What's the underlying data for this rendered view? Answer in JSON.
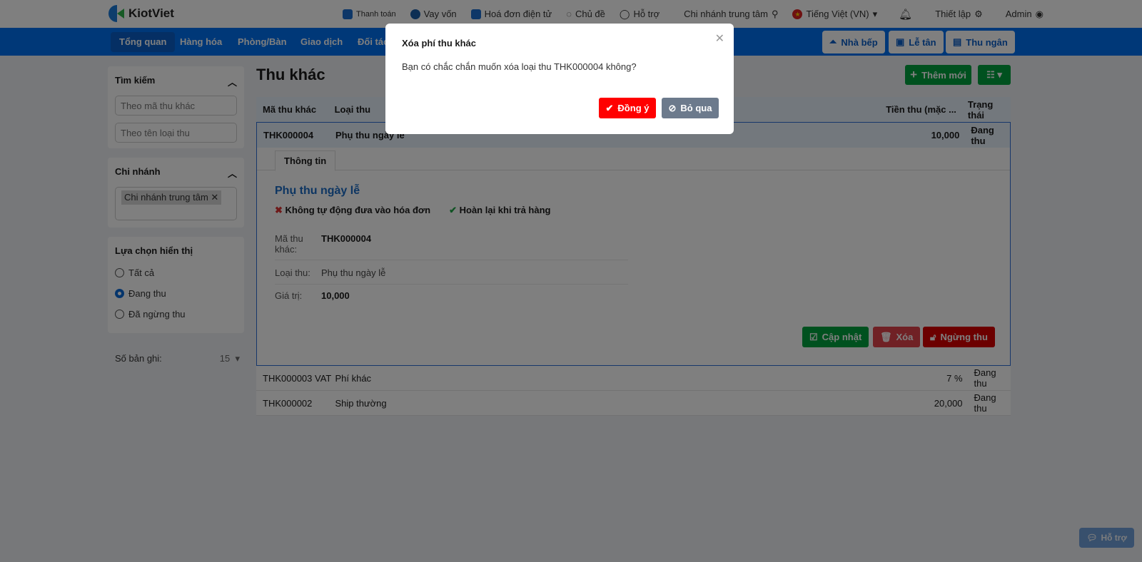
{
  "brand": {
    "name": "KiotViet"
  },
  "topbar": {
    "links": [
      "Thanh toán",
      "Vay vốn",
      "Hoá đơn điện tử",
      "Chủ đề",
      "Hỗ trợ"
    ],
    "branch": "Chi nhánh trung tâm",
    "language": "Tiếng Việt (VN)",
    "settings": "Thiết lập",
    "user": "Admin"
  },
  "nav": {
    "items": [
      "Tổng quan",
      "Hàng hóa",
      "Phòng/Bàn",
      "Giao dịch",
      "Đối tác"
    ],
    "right": [
      "Nhà bếp",
      "Lễ tân",
      "Thu ngân"
    ]
  },
  "sidebar": {
    "search": {
      "title": "Tìm kiếm",
      "ph1": "Theo mã thu khác",
      "ph2": "Theo tên loại thu"
    },
    "branch": {
      "title": "Chi nhánh",
      "tag": "Chi nhánh trung tâm"
    },
    "display": {
      "title": "Lựa chọn hiển thị",
      "options": [
        "Tất cả",
        "Đang thu",
        "Đã ngừng thu"
      ],
      "selected": 1
    },
    "records": {
      "label": "Số bản ghi:",
      "value": "15"
    }
  },
  "main": {
    "title": "Thu khác",
    "add": "Thêm mới",
    "columns": [
      "Mã thu khác",
      "Loại thu",
      "Tiền thu (mặc ...",
      "Trạng thái"
    ],
    "rows": [
      {
        "code": "THK000004",
        "type": "Phụ thu ngày lễ",
        "amount": "10,000",
        "status": "Đang thu"
      },
      {
        "code": "THK000003 VAT",
        "type": "Phí khác",
        "amount": "7 %",
        "status": "Đang thu"
      },
      {
        "code": "THK000002",
        "type": "Ship thường",
        "amount": "20,000",
        "status": "Đang thu"
      }
    ],
    "detail": {
      "tab": "Thông tin",
      "name": "Phụ thu ngày lễ",
      "flag1": "Không tự động đưa vào hóa đơn",
      "flag2": "Hoàn lại khi trả hàng",
      "f_code_l": "Mã thu khác:",
      "f_code": "THK000004",
      "f_type_l": "Loại thu:",
      "f_type": "Phụ thu ngày lễ",
      "f_val_l": "Giá trị:",
      "f_val": "10,000",
      "update": "Cập nhật",
      "delete": "Xóa",
      "stop": "Ngừng thu"
    }
  },
  "dialog": {
    "title": "Xóa phí thu khác",
    "message": "Bạn có chắc chắn muốn xóa loại thu THK000004 không?",
    "ok": "Đồng ý",
    "cancel": "Bỏ qua"
  },
  "help": "Hỗ trợ"
}
